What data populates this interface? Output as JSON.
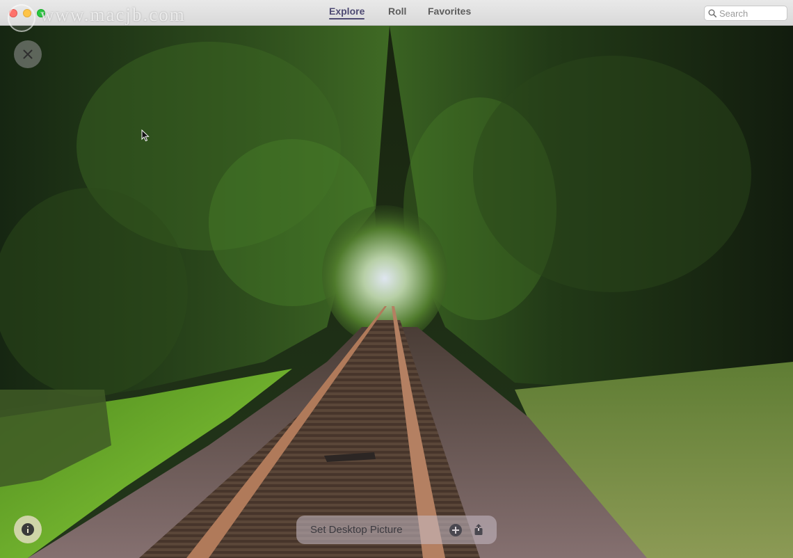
{
  "window": {
    "traffic_lights": [
      "close",
      "minimize",
      "maximize"
    ]
  },
  "watermark": {
    "text": "www.macjb.com"
  },
  "tabs": [
    {
      "label": "Explore",
      "active": true
    },
    {
      "label": "Roll",
      "active": false
    },
    {
      "label": "Favorites",
      "active": false
    }
  ],
  "search": {
    "placeholder": "Search",
    "value": ""
  },
  "overlay": {
    "close_icon": "close-icon",
    "info_icon": "info-icon"
  },
  "action_bar": {
    "set_desktop_label": "Set Desktop Picture",
    "add_icon": "plus-circle-icon",
    "share_icon": "share-icon"
  },
  "colors": {
    "active_tab": "#4e4a73",
    "inactive_tab": "#5d5d5d"
  }
}
